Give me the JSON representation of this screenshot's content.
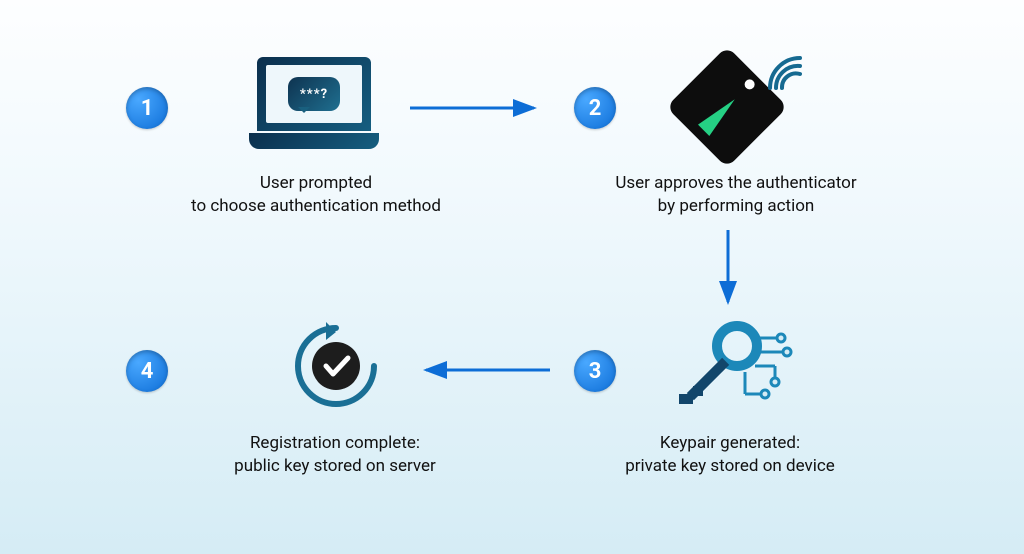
{
  "flow": {
    "type": "process-diagram",
    "steps": [
      {
        "number": "1",
        "caption_line1": "User prompted",
        "caption_line2": "to choose authentication method",
        "icon": "laptop-prompt-icon",
        "bubble_text": "***?"
      },
      {
        "number": "2",
        "caption_line1": "User approves the authenticator",
        "caption_line2": "by performing action",
        "icon": "security-key-tag-icon"
      },
      {
        "number": "3",
        "caption_line1": "Keypair generated:",
        "caption_line2": "private key stored on device",
        "icon": "key-circuit-icon"
      },
      {
        "number": "4",
        "caption_line1": "Registration complete:",
        "caption_line2": "public key stored on server",
        "icon": "refresh-checkmark-icon"
      }
    ],
    "arrows": [
      {
        "from": 1,
        "to": 2,
        "dir": "right"
      },
      {
        "from": 2,
        "to": 3,
        "dir": "down"
      },
      {
        "from": 3,
        "to": 4,
        "dir": "left"
      }
    ],
    "colors": {
      "badge_gradient_from": "#49a8ff",
      "badge_gradient_to": "#0d6dd6",
      "arrow": "#0d6dd6",
      "text": "#0d0d0d",
      "icon_dark": "#0e3350",
      "icon_teal": "#1f6f90",
      "nfc": "#166a91",
      "accent_green": "#25d084"
    }
  }
}
